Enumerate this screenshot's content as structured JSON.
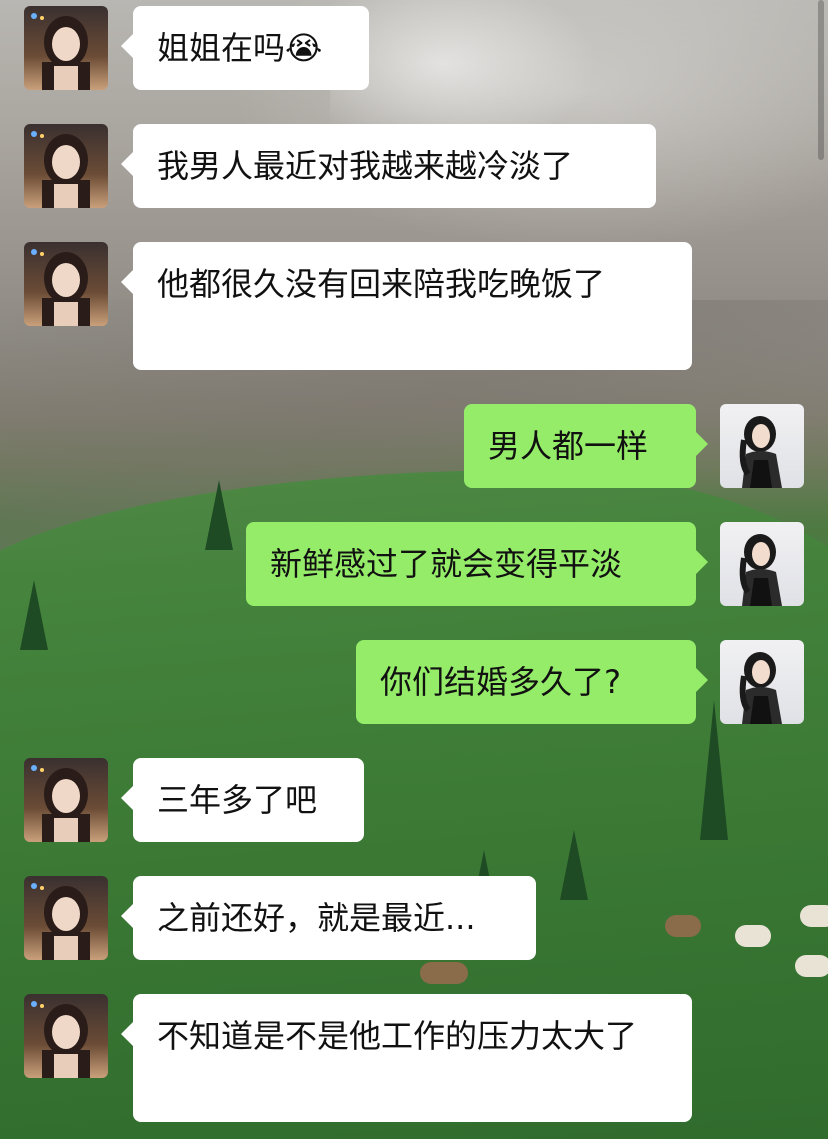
{
  "messages": [
    {
      "side": "left",
      "text": "姐姐在吗😭"
    },
    {
      "side": "left",
      "text": "我男人最近对我越来越冷淡了"
    },
    {
      "side": "left",
      "text": "他都很久没有回来陪我吃晚饭了"
    },
    {
      "side": "right",
      "text": "男人都一样"
    },
    {
      "side": "right",
      "text": "新鲜感过了就会变得平淡"
    },
    {
      "side": "right",
      "text": "你们结婚多久了?"
    },
    {
      "side": "left",
      "text": "三年多了吧"
    },
    {
      "side": "left",
      "text": "之前还好，就是最近..."
    },
    {
      "side": "left",
      "text": "不知道是不是他工作的压力太大了"
    }
  ],
  "colors": {
    "incoming_bubble": "#ffffff",
    "outgoing_bubble": "#95ec69",
    "text": "#111111"
  },
  "icons": {
    "incoming_avatar": "woman-long-hair-avatar",
    "outgoing_avatar": "woman-dark-hair-avatar"
  }
}
